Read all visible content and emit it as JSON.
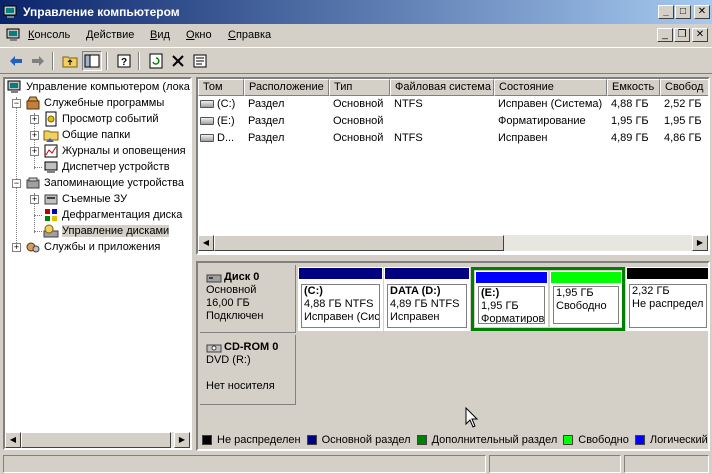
{
  "window": {
    "title": "Управление компьютером"
  },
  "menu": [
    {
      "label": "Консоль",
      "accel": "К",
      "rest": "онсоль"
    },
    {
      "label": "Действие",
      "accel": "Д",
      "rest": "ействие"
    },
    {
      "label": "Вид",
      "accel": "В",
      "rest": "ид"
    },
    {
      "label": "Окно",
      "accel": "О",
      "rest": "кно"
    },
    {
      "label": "Справка",
      "accel": "С",
      "rest": "правка"
    }
  ],
  "tree": {
    "root": "Управление компьютером (лока",
    "system_tools": "Служебные программы",
    "event_viewer": "Просмотр событий",
    "shared_folders": "Общие папки",
    "logs_alerts": "Журналы и оповещения",
    "device_manager": "Диспетчер устройств",
    "storage": "Запоминающие устройства",
    "removable": "Съемные ЗУ",
    "defrag": "Дефрагментация диска",
    "disk_mgmt": "Управление дисками",
    "services_apps": "Службы и приложения"
  },
  "volumes": {
    "columns": [
      "Том",
      "Расположение",
      "Тип",
      "Файловая система",
      "Состояние",
      "Емкость",
      "Свобод"
    ],
    "rows": [
      [
        "(C:)",
        "Раздел",
        "Основной",
        "NTFS",
        "Исправен (Система)",
        "4,88 ГБ",
        "2,52 ГБ"
      ],
      [
        "(E:)",
        "Раздел",
        "Основной",
        "",
        "Форматирование",
        "1,95 ГБ",
        "1,95 ГБ"
      ],
      [
        "D...",
        "Раздел",
        "Основной",
        "NTFS",
        "Исправен",
        "4,89 ГБ",
        "4,86 ГБ"
      ]
    ]
  },
  "disk0": {
    "name": "Диск 0",
    "type": "Основной",
    "size": "16,00 ГБ",
    "status": "Подключен",
    "partitions": [
      {
        "name": "(C:)",
        "size": "4,88 ГБ NTFS",
        "state": "Исправен (Сис",
        "color": "#000080"
      },
      {
        "name": "DATA  (D:)",
        "size": "4,89 ГБ NTFS",
        "state": "Исправен",
        "color": "#000080"
      },
      {
        "name": "(E:)",
        "size": "1,95 ГБ",
        "state": "Форматиров",
        "color": "#0000ff"
      },
      {
        "name": "",
        "size": "1,95 ГБ",
        "state": "Свободно",
        "color": "#00ff00"
      },
      {
        "name": "",
        "size": "2,32 ГБ",
        "state": "Не распредел",
        "color": "#000000"
      }
    ]
  },
  "cdrom0": {
    "name": "CD-ROM 0",
    "type": "DVD (R:)",
    "status": "Нет носителя"
  },
  "legend": [
    {
      "label": "Не распределен",
      "color": "#000000"
    },
    {
      "label": "Основной раздел",
      "color": "#000080"
    },
    {
      "label": "Дополнительный раздел",
      "color": "#008000"
    },
    {
      "label": "Свободно",
      "color": "#00ff00"
    },
    {
      "label": "Логический",
      "color": "#0000ff"
    }
  ]
}
